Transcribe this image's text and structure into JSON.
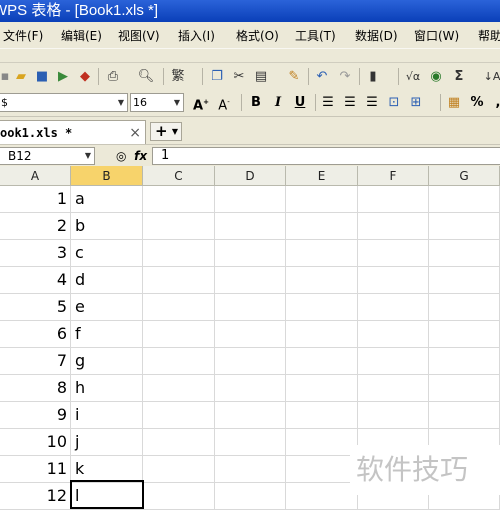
{
  "title": "WPS 表格 - [Book1.xls *]",
  "menu": [
    "文件(F)",
    "编辑(E)",
    "视图(V)",
    "插入(I)",
    "格式(O)",
    "工具(T)",
    "数据(D)",
    "窗口(W)",
    "帮助"
  ],
  "toolbar2": {
    "font_name": "$",
    "font_size": "16"
  },
  "tab": {
    "label": "ook1.xls *",
    "close": "×",
    "new": "+"
  },
  "formula": {
    "name_box": "B12",
    "value": "1"
  },
  "columns": [
    "A",
    "B",
    "C",
    "D",
    "E",
    "F",
    "G"
  ],
  "rows": [
    {
      "a": "1",
      "b": "a"
    },
    {
      "a": "2",
      "b": "b"
    },
    {
      "a": "3",
      "b": "c"
    },
    {
      "a": "4",
      "b": "d"
    },
    {
      "a": "5",
      "b": "e"
    },
    {
      "a": "6",
      "b": "f"
    },
    {
      "a": "7",
      "b": "g"
    },
    {
      "a": "8",
      "b": "h"
    },
    {
      "a": "9",
      "b": "i"
    },
    {
      "a": "10",
      "b": "j"
    },
    {
      "a": "11",
      "b": "k"
    },
    {
      "a": "12",
      "b": "l"
    }
  ],
  "watermark": "软件技巧",
  "icons": [
    "new-icon",
    "open-icon",
    "save-icon",
    "export-icon",
    "pdf-icon",
    "print-icon",
    "preview-icon",
    "convert-icon",
    "copy-icon",
    "cut-icon",
    "paste-icon",
    "format-painter-icon",
    "undo-icon",
    "redo-icon",
    "row-icon",
    "formula-icon",
    "function-icon",
    "sum-icon",
    "sort-icon"
  ]
}
